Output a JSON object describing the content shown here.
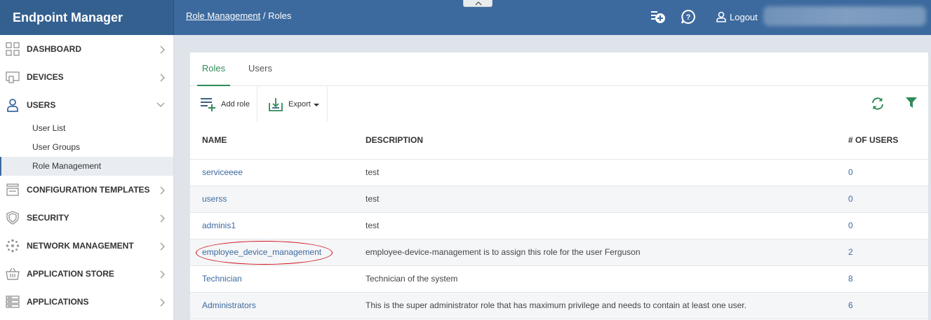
{
  "header": {
    "app_title": "Endpoint Manager",
    "breadcrumb_link": "Role Management",
    "breadcrumb_separator": "/",
    "breadcrumb_current": "Roles",
    "icons": [
      "add-task-icon",
      "help-icon",
      "user-icon"
    ],
    "logout_label": "Logout"
  },
  "sidebar": {
    "items": [
      {
        "label": "DASHBOARD",
        "icon": "dashboard-icon"
      },
      {
        "label": "DEVICES",
        "icon": "devices-icon"
      },
      {
        "label": "USERS",
        "icon": "user-icon"
      },
      {
        "label": "CONFIGURATION TEMPLATES",
        "icon": "templates-icon"
      },
      {
        "label": "SECURITY",
        "icon": "shield-icon"
      },
      {
        "label": "NETWORK MANAGEMENT",
        "icon": "network-icon"
      },
      {
        "label": "APPLICATION STORE",
        "icon": "store-icon"
      },
      {
        "label": "APPLICATIONS",
        "icon": "applications-icon"
      }
    ],
    "users_sub": [
      "User List",
      "User Groups",
      "Role Management"
    ],
    "active_sub": "Role Management"
  },
  "tabs": [
    {
      "label": "Roles",
      "active": true
    },
    {
      "label": "Users",
      "active": false
    }
  ],
  "toolbar": {
    "add_role_label": "Add role",
    "export_label": "Export",
    "icons": [
      "refresh-icon",
      "filter-icon"
    ]
  },
  "table": {
    "columns": [
      "NAME",
      "DESCRIPTION",
      "# OF USERS"
    ],
    "rows": [
      {
        "name": "serviceeee",
        "description": "test",
        "users": "0"
      },
      {
        "name": "userss",
        "description": "test",
        "users": "0"
      },
      {
        "name": "adminis1",
        "description": "test",
        "users": "0"
      },
      {
        "name": "employee_device_management",
        "description": "employee-device-management is to assign this role for the user Ferguson",
        "users": "2"
      },
      {
        "name": "Technician",
        "description": "Technician of the system",
        "users": "8"
      },
      {
        "name": "Administrators",
        "description": "This is the super administrator role that has maximum privilege and needs to contain at least one user.",
        "users": "6"
      }
    ]
  },
  "colors": {
    "header_bg": "#3d6a9e",
    "brand_bg": "#34608f",
    "accent_green": "#2e8b57",
    "link_blue": "#3d6a9e",
    "highlight_red": "#d0141c"
  }
}
